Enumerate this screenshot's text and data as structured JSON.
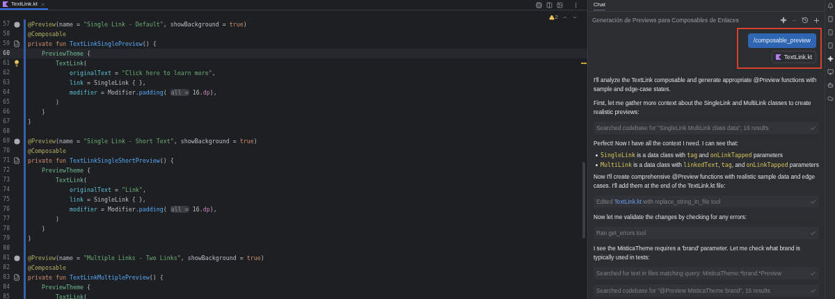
{
  "editor": {
    "tabs": [
      {
        "label": "TextLink.kt",
        "selected": true
      }
    ],
    "warnings": "2",
    "lines": [
      {
        "number": "57",
        "kind": "preview",
        "current": false,
        "tokens": [
          {
            "kind": "annotation",
            "text": "@Preview"
          },
          {
            "kind": "plain",
            "text": "(name = "
          },
          {
            "kind": "string",
            "text": "\"Single Link - Default\""
          },
          {
            "kind": "plain",
            "text": ", showBackground = "
          },
          {
            "kind": "keyword",
            "text": "true"
          },
          {
            "kind": "plain",
            "text": ")"
          }
        ]
      },
      {
        "number": "58",
        "kind": "code",
        "current": false,
        "tokens": [
          {
            "kind": "annotation",
            "text": "@Composable"
          }
        ]
      },
      {
        "number": "59",
        "kind": "run",
        "current": false,
        "tokens": [
          {
            "kind": "keyword",
            "text": "private fun "
          },
          {
            "kind": "function",
            "text": "TextLinkSinglePreview"
          },
          {
            "kind": "plain",
            "text": "() {"
          }
        ]
      },
      {
        "number": "60",
        "kind": "code",
        "current": true,
        "tokens": [
          {
            "kind": "call",
            "text": "    PreviewTheme"
          },
          {
            "kind": "plain",
            "text": " {"
          }
        ]
      },
      {
        "number": "61",
        "kind": "bulb",
        "current": false,
        "tokens": [
          {
            "kind": "call",
            "text": "        TextLink"
          },
          {
            "kind": "plain",
            "text": "("
          }
        ]
      },
      {
        "number": "62",
        "kind": "code",
        "current": false,
        "tokens": [
          {
            "kind": "param",
            "text": "            originalText"
          },
          {
            "kind": "plain",
            "text": " = "
          },
          {
            "kind": "string",
            "text": "\"Click here to learn more\""
          },
          {
            "kind": "plain",
            "text": ","
          }
        ]
      },
      {
        "number": "63",
        "kind": "code",
        "current": false,
        "tokens": [
          {
            "kind": "param",
            "text": "            link"
          },
          {
            "kind": "plain",
            "text": " = SingleLink { },"
          }
        ]
      },
      {
        "number": "64",
        "kind": "code",
        "current": false,
        "tokens": [
          {
            "kind": "param",
            "text": "            modifier"
          },
          {
            "kind": "plain",
            "text": " = Modifier."
          },
          {
            "kind": "method",
            "text": "padding"
          },
          {
            "kind": "plain",
            "text": "( "
          },
          {
            "kind": "hint",
            "text": "all ="
          },
          {
            "kind": "plain",
            "text": " 16."
          },
          {
            "kind": "unit",
            "text": "dp"
          },
          {
            "kind": "plain",
            "text": "),"
          }
        ]
      },
      {
        "number": "65",
        "kind": "code",
        "current": false,
        "tokens": [
          {
            "kind": "plain",
            "text": "        )"
          }
        ]
      },
      {
        "number": "66",
        "kind": "code",
        "current": false,
        "tokens": [
          {
            "kind": "plain",
            "text": "    }"
          }
        ]
      },
      {
        "number": "67",
        "kind": "code",
        "current": false,
        "tokens": [
          {
            "kind": "plain",
            "text": "}"
          }
        ]
      },
      {
        "number": "68",
        "kind": "code",
        "current": false
      },
      {
        "number": "69",
        "kind": "preview",
        "current": false,
        "tokens": [
          {
            "kind": "annotation",
            "text": "@Preview"
          },
          {
            "kind": "plain",
            "text": "(name = "
          },
          {
            "kind": "string",
            "text": "\"Single Link - Short Text\""
          },
          {
            "kind": "plain",
            "text": ", showBackground = "
          },
          {
            "kind": "keyword",
            "text": "true"
          },
          {
            "kind": "plain",
            "text": ")"
          }
        ]
      },
      {
        "number": "70",
        "kind": "code",
        "current": false,
        "tokens": [
          {
            "kind": "annotation",
            "text": "@Composable"
          }
        ]
      },
      {
        "number": "71",
        "kind": "run",
        "current": false,
        "tokens": [
          {
            "kind": "keyword",
            "text": "private fun "
          },
          {
            "kind": "function",
            "text": "TextLinkSingleShortPreview"
          },
          {
            "kind": "plain",
            "text": "() {"
          }
        ]
      },
      {
        "number": "72",
        "kind": "code",
        "current": false,
        "tokens": [
          {
            "kind": "call",
            "text": "    PreviewTheme"
          },
          {
            "kind": "plain",
            "text": " {"
          }
        ]
      },
      {
        "number": "73",
        "kind": "code",
        "current": false,
        "tokens": [
          {
            "kind": "call",
            "text": "        TextLink"
          },
          {
            "kind": "plain",
            "text": "("
          }
        ]
      },
      {
        "number": "74",
        "kind": "code",
        "current": false,
        "tokens": [
          {
            "kind": "param",
            "text": "            originalText"
          },
          {
            "kind": "plain",
            "text": " = "
          },
          {
            "kind": "string",
            "text": "\"Link\""
          },
          {
            "kind": "plain",
            "text": ","
          }
        ]
      },
      {
        "number": "75",
        "kind": "code",
        "current": false,
        "tokens": [
          {
            "kind": "param",
            "text": "            link"
          },
          {
            "kind": "plain",
            "text": " = SingleLink { },"
          }
        ]
      },
      {
        "number": "76",
        "kind": "code",
        "current": false,
        "tokens": [
          {
            "kind": "param",
            "text": "            modifier"
          },
          {
            "kind": "plain",
            "text": " = Modifier."
          },
          {
            "kind": "method",
            "text": "padding"
          },
          {
            "kind": "plain",
            "text": "( "
          },
          {
            "kind": "hint",
            "text": "all ="
          },
          {
            "kind": "plain",
            "text": " 16."
          },
          {
            "kind": "unit",
            "text": "dp"
          },
          {
            "kind": "plain",
            "text": "),"
          }
        ]
      },
      {
        "number": "77",
        "kind": "code",
        "current": false,
        "tokens": [
          {
            "kind": "plain",
            "text": "        )"
          }
        ]
      },
      {
        "number": "78",
        "kind": "code",
        "current": false,
        "tokens": [
          {
            "kind": "plain",
            "text": "    }"
          }
        ]
      },
      {
        "number": "79",
        "kind": "code",
        "current": false,
        "tokens": [
          {
            "kind": "plain",
            "text": "}"
          }
        ]
      },
      {
        "number": "80",
        "kind": "code",
        "current": false
      },
      {
        "number": "81",
        "kind": "preview",
        "current": false,
        "tokens": [
          {
            "kind": "annotation",
            "text": "@Preview"
          },
          {
            "kind": "plain",
            "text": "(name = "
          },
          {
            "kind": "string",
            "text": "\"Multiple Links - Two Links\""
          },
          {
            "kind": "plain",
            "text": ", showBackground = "
          },
          {
            "kind": "keyword",
            "text": "true"
          },
          {
            "kind": "plain",
            "text": ")"
          }
        ]
      },
      {
        "number": "82",
        "kind": "code",
        "current": false,
        "tokens": [
          {
            "kind": "annotation",
            "text": "@Composable"
          }
        ]
      },
      {
        "number": "83",
        "kind": "run",
        "current": false,
        "tokens": [
          {
            "kind": "keyword",
            "text": "private fun "
          },
          {
            "kind": "function",
            "text": "TextLinkMultiplePreview"
          },
          {
            "kind": "plain",
            "text": "() {"
          }
        ]
      },
      {
        "number": "84",
        "kind": "code",
        "current": false,
        "tokens": [
          {
            "kind": "call",
            "text": "    PreviewTheme"
          },
          {
            "kind": "plain",
            "text": " {"
          }
        ]
      },
      {
        "number": "85",
        "kind": "code",
        "current": false,
        "tokens": [
          {
            "kind": "call",
            "text": "        TextLink"
          },
          {
            "kind": "plain",
            "text": "("
          }
        ]
      }
    ]
  },
  "chat": {
    "tab": "Chat",
    "title": "Generación de Previews para Composables de Enlaces",
    "command": "/composable_preview",
    "attachment": "TextLink.kt",
    "messages": [
      {
        "kind": "text",
        "segments": [
          {
            "text": "I'll analyze the TextLink composable and generate appropriate @Preview functions with sample and edge-case states."
          }
        ]
      },
      {
        "kind": "text",
        "segments": [
          {
            "text": "First, let me gather more context about the SingleLink and MultiLink classes to create realistic previews:"
          }
        ]
      },
      {
        "kind": "tool",
        "done": true,
        "segments": [
          {
            "text": "Searched codebase for \"SingleLink MultiLink class data\", 16 results"
          }
        ]
      },
      {
        "kind": "text",
        "segments": [
          {
            "text": "Perfect! Now I have all the context I need. I can see that:"
          }
        ]
      },
      {
        "kind": "bullet",
        "segments": [
          {
            "text": "SingleLink",
            "code": true
          },
          {
            "text": " is a data class with "
          },
          {
            "text": "tag",
            "code": true
          },
          {
            "text": " and "
          },
          {
            "text": "onLinkTapped",
            "code": true
          },
          {
            "text": " parameters"
          }
        ]
      },
      {
        "kind": "bullet",
        "segments": [
          {
            "text": "MultiLink",
            "code": true
          },
          {
            "text": " is a data class with "
          },
          {
            "text": "linkedText",
            "code": true
          },
          {
            "text": ", "
          },
          {
            "text": "tag",
            "code": true
          },
          {
            "text": ", and "
          },
          {
            "text": "onLinkTapped",
            "code": true
          },
          {
            "text": " parameters"
          }
        ]
      },
      {
        "kind": "text",
        "segments": [
          {
            "text": "Now I'll create comprehensive @Preview functions with realistic sample data and edge cases. I'll add them at the end of the TextLink.kt file:"
          }
        ]
      },
      {
        "kind": "tool",
        "done": true,
        "segments": [
          {
            "text": "Edited "
          },
          {
            "text": "TextLink.kt",
            "link": true
          },
          {
            "text": " with replace_string_in_file tool"
          }
        ]
      },
      {
        "kind": "text",
        "segments": [
          {
            "text": "Now let me validate the changes by checking for any errors:"
          }
        ]
      },
      {
        "kind": "tool",
        "done": true,
        "segments": [
          {
            "text": "Ran get_errors tool"
          }
        ]
      },
      {
        "kind": "text",
        "segments": [
          {
            "text": "I see the MisticaTheme requires a 'brand' parameter. Let me check what brand is typically used in tests:"
          }
        ]
      },
      {
        "kind": "tool",
        "done": true,
        "segments": [
          {
            "text": "Searched for text in files matching query: MisticaTheme.*brand.*Preview"
          }
        ]
      },
      {
        "kind": "tool",
        "done": true,
        "segments": [
          {
            "text": "Searched codebase for \"@Preview MisticaTheme brand\", 16 results"
          }
        ]
      }
    ]
  }
}
